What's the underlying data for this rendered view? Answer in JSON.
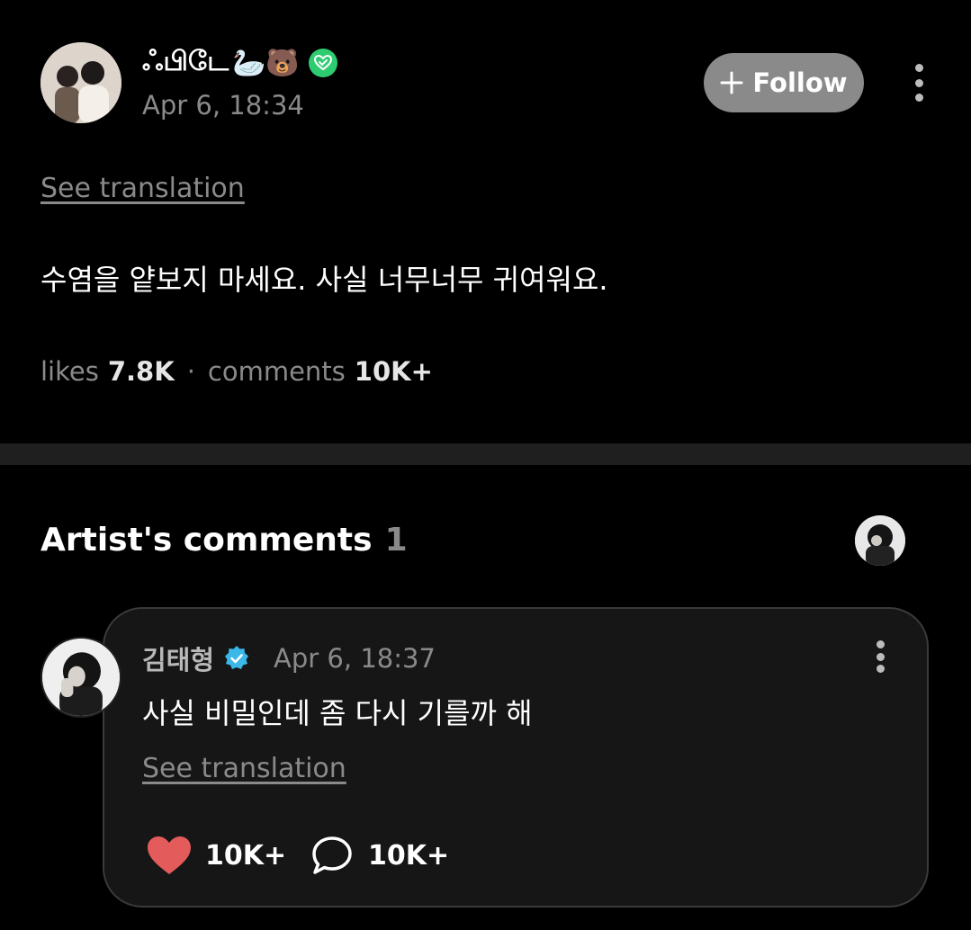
{
  "post": {
    "author_name": "ஃபிடே",
    "author_emoji": "🦢🐻",
    "timestamp": "Apr 6, 18:34",
    "follow_label": "Follow",
    "see_translation": "See translation",
    "body": "수염을 얕보지 마세요. 사실 너무너무 귀여워요.",
    "likes_label": "likes",
    "likes_value": "7.8K",
    "separator": "·",
    "comments_label": "comments",
    "comments_value": "10K+"
  },
  "artist_comments": {
    "title": "Artist's comments",
    "count": "1"
  },
  "comment": {
    "author_name": "김태형",
    "timestamp": "Apr 6, 18:37",
    "body": "사실 비밀인데 좀 다시 기를까 해",
    "see_translation": "See translation",
    "likes_value": "10K+",
    "replies_value": "10K+"
  },
  "colors": {
    "background": "#000000",
    "follow_button": "#8a8a8a",
    "heart": "#e35b5b",
    "verified_green": "#2ecc71",
    "verified_blue": "#3ab8e8"
  },
  "icons": [
    "plus-icon",
    "kebab-menu-icon",
    "verified-green-icon",
    "verified-blue-icon",
    "heart-icon",
    "comment-bubble-icon"
  ]
}
